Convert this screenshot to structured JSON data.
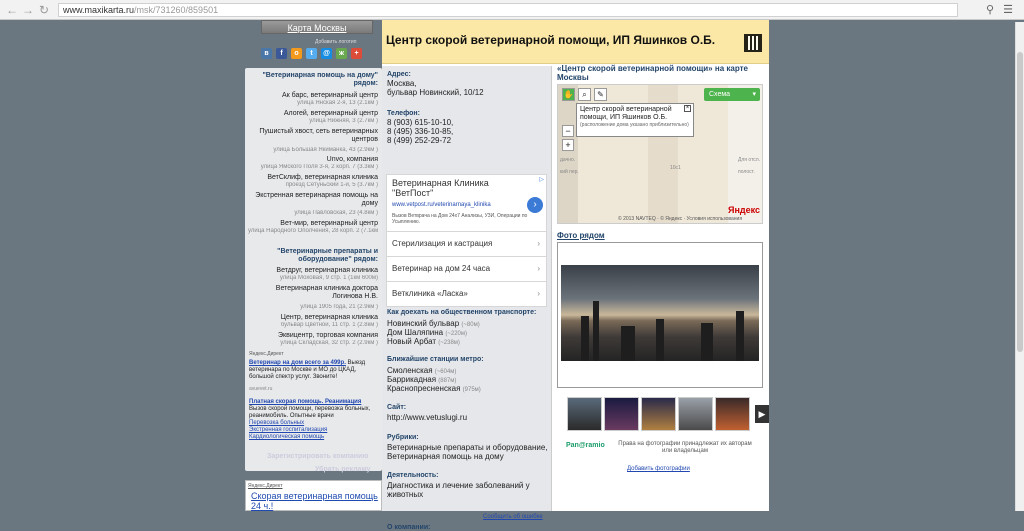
{
  "browser": {
    "url_host": "www.maxikarta.ru",
    "url_path": "/msk/731260/859501"
  },
  "left": {
    "map_button": "Карта Москвы",
    "add_logo": "Добавить логотип",
    "nearby_header": "\"Ветеринарная помощь на дому\" рядом:",
    "nearby": [
      {
        "name": "Ак барс, ветеринарный центр",
        "addr": "улица Янская 2-я, 13 (2.1км )"
      },
      {
        "name": "Алогей, ветеринарный центр",
        "addr": "улица Нижняя, 3 (2.7км )"
      },
      {
        "name": "Пушистый хвост, сеть ветеринарных центров",
        "addr": "улица Большая Якиманка, 43 (2.9км )"
      },
      {
        "name": "Unvo, компания",
        "addr": "улица Ямского Поля 3-я, 2 корп. 7 (3.3км )"
      },
      {
        "name": "ВетСклиф, ветеринарная клиника",
        "addr": "проезд Сетуньский 1-й, 5 (3.7км )"
      },
      {
        "name": "Экстренная ветеринарная помощь на дому",
        "addr": "улица Павловская, 23 (4.8км )"
      },
      {
        "name": "Вет-мир, ветеринарный центр",
        "addr": "улица Народного Ополчения, 28 корп. 2 (7.1км )"
      }
    ],
    "supply_header": "\"Ветеринарные препараты и оборудование\" рядом:",
    "supply": [
      {
        "name": "Ветдруг, ветеринарная клиника",
        "addr": "улица Моховая, 9 стр. 1 (1км 600м)"
      },
      {
        "name": "Ветеринарная клиника доктора Логинова Н.В.",
        "addr": "улица 1905 года, 21 (2.9км )"
      },
      {
        "name": "Центр, ветеринарная клиника",
        "addr": "бульвар Цветной, 11 стр. 1 (2.8км )"
      },
      {
        "name": "Эквицентр, торговая компания",
        "addr": "улица Складская, 32 стр. 2 (2.9км )"
      }
    ],
    "direct_label": "Яндекс.Директ",
    "ad1_title": "Ветеринар на дом всего за 499р.",
    "ad1_text": "Выезд ветеринара по Москве и МО до ЦКАД, большой спектр услуг. Звоните!",
    "ad1_domain": "avuevet.ru",
    "ad2_title": "Платная скорая помощь. Реанимация",
    "ad2_text": "Вызов скорой помощи, перевозка больных, реанимобиль. Опытные врачи",
    "ad2_links": [
      "Перевозка больных",
      "Экстренная госпитализация",
      "Кардиологическая помощь"
    ],
    "register": "Зарегистрировать компанию",
    "remove_ads": "Убрать рекламу",
    "bottom_direct": "Яндекс.Директ",
    "bottom_ad": "Скорая ветеринарная помощь 24 ч.!"
  },
  "header": {
    "title": "Центр скорой ветеринарной помощи, ИП Яшинков О.Б."
  },
  "info": {
    "address_label": "Адрес:",
    "address": [
      "Москва,",
      "бульвар Новинский, 10/12"
    ],
    "phone_label": "Телефон:",
    "phones": [
      "8 (903) 615-10-10,",
      "8 (495) 336-10-85,",
      "8 (499) 252-29-72"
    ],
    "gad_title": "Ветеринарная Клиника \"ВетПост\"",
    "gad_url": "www.vetpost.ru/veterinarnaya_klinika",
    "gad_desc": "Вызов Ветврача на Дом 24x7 Анализы, УЗИ, Операции по Усыплению.",
    "gad_links": [
      "Стерилизация и кастрация",
      "Ветеринар на дом 24 часа",
      "Ветклиника «Ласка»"
    ],
    "transport_label": "Как доехать на общественном транспорте:",
    "transport": [
      {
        "name": "Новинский бульвар",
        "dist": "(~80м)"
      },
      {
        "name": "Дом Шаляпина",
        "dist": "(~220м)"
      },
      {
        "name": "Новый Арбат",
        "dist": "(~238м)"
      }
    ],
    "metro_label": "Ближайшие станции метро:",
    "metro": [
      {
        "name": "Смоленская",
        "dist": "(~604м)"
      },
      {
        "name": "Баррикадная",
        "dist": "(887м)"
      },
      {
        "name": "Краснопресненская",
        "dist": "(975м)"
      }
    ],
    "site_label": "Сайт:",
    "site": "http://www.vetuslugi.ru",
    "rubrics_label": "Рубрики:",
    "rubrics": "Ветеринарные препараты и оборудование, Ветеринарная помощь на дому",
    "activity_label": "Деятельность:",
    "activity": "Диагностика и лечение заболеваний у животных",
    "report_error": "Сообщить об ошибке",
    "about_label": "О компании:"
  },
  "map": {
    "title": "«Центр скорой ветеринарной помощи» на карте Москвы",
    "schema": "Схема",
    "popup_title": "Центр скорой ветеринарной помощи, ИП Яшинков О.Б.",
    "popup_note": "(расположение дома указано приблизительно)",
    "copyright": "© 2013 NAVTEQ · © Яндекс · Условия использования",
    "yandex": "Яндекс",
    "labels": [
      "дачно.",
      "кий пер.",
      "Для отсл.",
      "полост.",
      "10с1"
    ]
  },
  "photos": {
    "title": "Фото рядом",
    "panoramio": "Pan@ramio",
    "rights": "Права на фотографии принадлежат их авторам или владельцам",
    "add": "Добавить фотографии"
  },
  "colors": {
    "background": "#6b7780",
    "header": "#fbe8a6",
    "link": "#23456a",
    "schema": "#4db34c"
  }
}
